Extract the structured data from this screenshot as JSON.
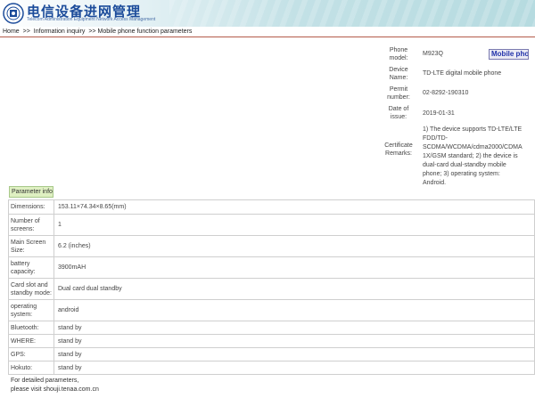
{
  "header": {
    "title": "电信设备进网管理",
    "subtitle": "Telecom Administration Equipment Network Access Management",
    "logo_icon": "circular-emblem-icon",
    "accent_color": "#1b4b9a"
  },
  "breadcrumb": {
    "home": "Home",
    "sep1": ">>",
    "info": "Information inquiry",
    "sep2": ">>",
    "current": "Mobile phone function parameters"
  },
  "device": {
    "model_label": "Phone model:",
    "model_value": "M923Q",
    "name_label": "Device Name:",
    "name_value": "TD-LTE digital mobile phone",
    "permit_label": "Permit number:",
    "permit_value": "02-8292-190310",
    "date_label": "Date of issue:",
    "date_value": "2019-01-31",
    "cert_label": "Certificate Remarks:",
    "cert_value": "1) The device supports TD-LTE/LTE FDD/TD-SCDMA/WCDMA/cdma2000/CDMA 1X/GSM standard; 2) the device is dual-card dual-standby mobile phone; 3) operating system: Android.",
    "badge": "Mobile phone"
  },
  "params": {
    "header": "Parameter info",
    "rows": [
      {
        "key": "Dimensions:",
        "value": "153.11×74.34×8.65(mm)"
      },
      {
        "key": "Number of screens:",
        "value": "1"
      },
      {
        "key": "Main Screen Size:",
        "value": "6.2 (inches)"
      },
      {
        "key": "battery capacity:",
        "value": "3900mAH"
      },
      {
        "key": "Card slot and standby mode:",
        "value": "Dual card dual standby"
      },
      {
        "key": "operating system:",
        "value": "android"
      },
      {
        "key": "Bluetooth:",
        "value": "stand by"
      },
      {
        "key": "WHERE:",
        "value": "stand by"
      },
      {
        "key": "GPS:",
        "value": "stand by"
      },
      {
        "key": "Hokuto:",
        "value": "stand by"
      }
    ]
  },
  "footer": {
    "line1": "For detailed parameters,",
    "line2": "please visit",
    "link": "shouji.tenaa.com.cn"
  }
}
